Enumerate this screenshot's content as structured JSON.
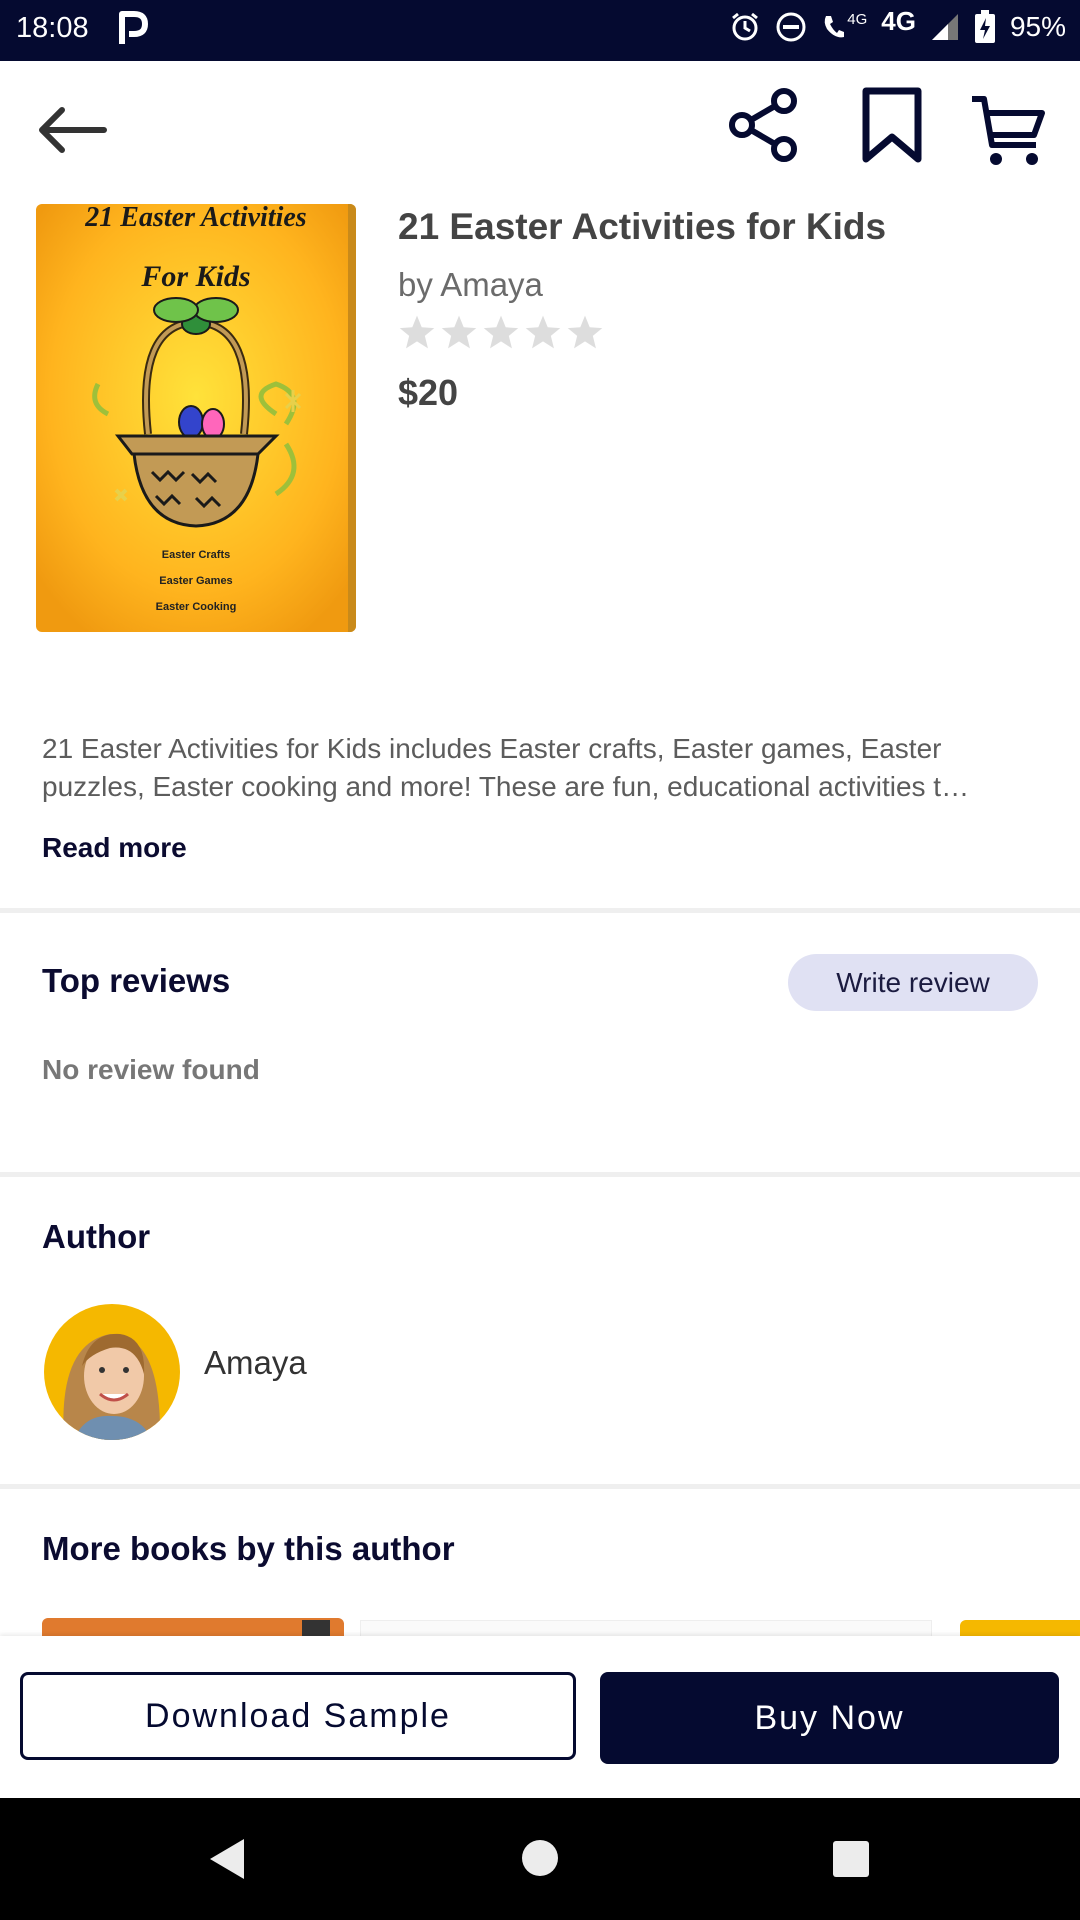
{
  "status_bar": {
    "time": "18:08",
    "network_small": "4G",
    "network": "4G",
    "battery": "95%"
  },
  "book": {
    "title": "21 Easter Activities for Kids",
    "author": "by Amaya",
    "rating_stars": 0,
    "price": "$20",
    "cover": {
      "title_line1": "21 Easter Activities",
      "title_line2": "For Kids",
      "items": [
        "Easter Crafts",
        "Easter Games",
        "Easter Cooking"
      ]
    }
  },
  "description": {
    "text": "21 Easter Activities for Kids includes Easter crafts, Easter games, Easter puzzles, Easter cooking and more! These are fun, educational activities t…",
    "read_more": "Read more"
  },
  "reviews": {
    "title": "Top reviews",
    "write_review": "Write review",
    "empty": "No review found"
  },
  "author_section": {
    "title": "Author",
    "name": "Amaya"
  },
  "more_books": {
    "title": "More books by this author"
  },
  "actions": {
    "download_sample": "Download Sample",
    "buy_now": "Buy Now"
  },
  "colors": {
    "navy": "#050a30",
    "chip": "#e0e1f3",
    "star_empty": "#dddddd"
  }
}
